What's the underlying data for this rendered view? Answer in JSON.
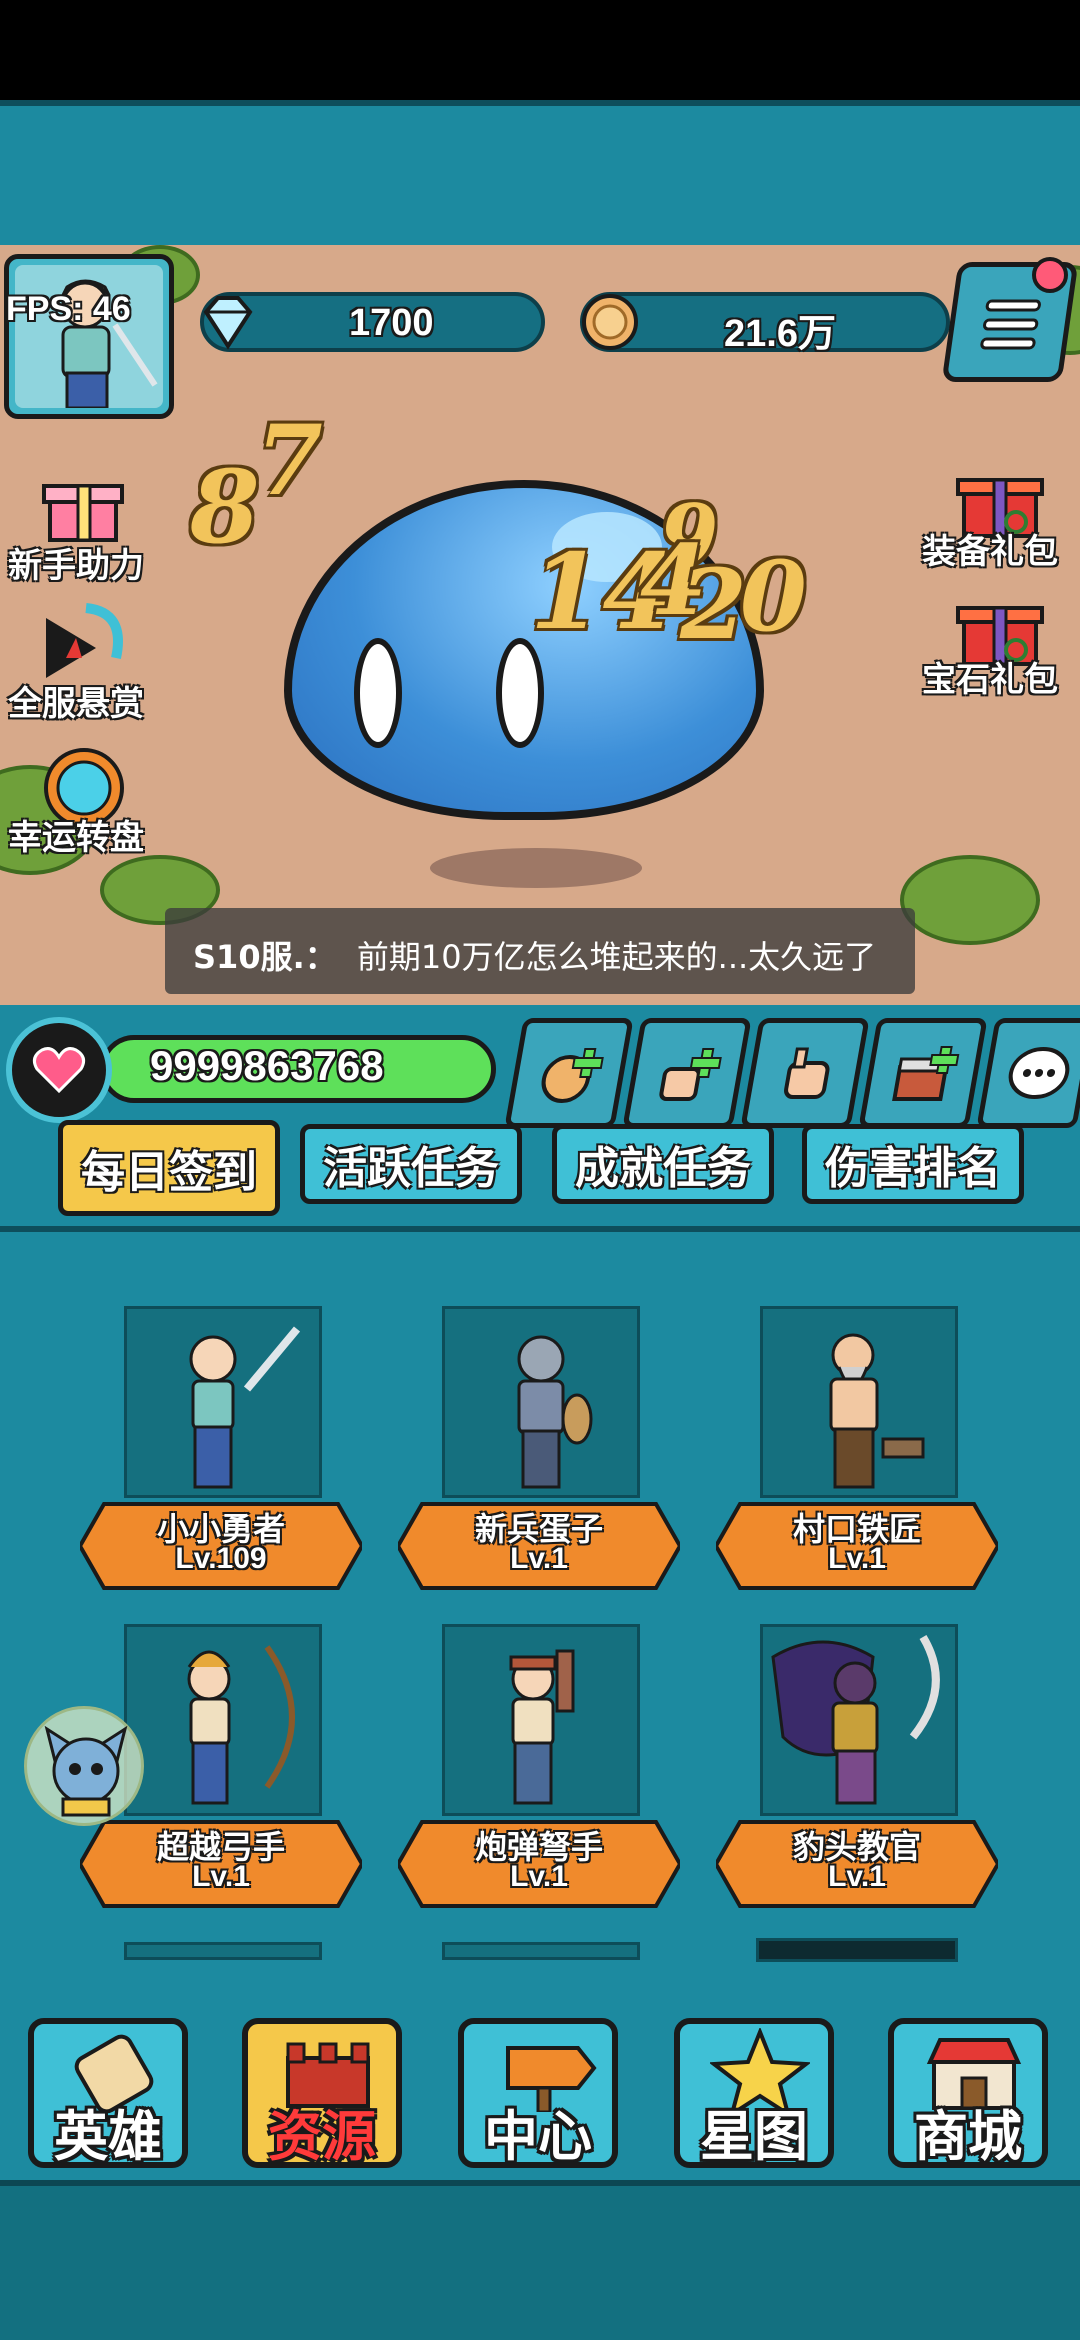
{
  "header": {
    "fps_label": "FPS: 46",
    "gems": "1700",
    "gold": "21.6万"
  },
  "side_left": [
    {
      "label": "新手助力",
      "icon": "gift-icon"
    },
    {
      "label": "全服悬赏",
      "icon": "bounty-icon"
    },
    {
      "label": "幸运转盘",
      "icon": "lucky-wheel-icon"
    }
  ],
  "side_right": [
    {
      "label": "装备礼包",
      "icon": "gift-box-icon"
    },
    {
      "label": "宝石礼包",
      "icon": "gift-box-icon"
    }
  ],
  "damage_numbers": [
    "8",
    "7",
    "9",
    "14",
    "4",
    "2",
    "0"
  ],
  "chat": {
    "sender": "S10服.：",
    "message": "前期10万亿怎么堆起来的...太久远了"
  },
  "hp": {
    "value": "9999863768"
  },
  "quick_buttons": [
    "add-gold-icon",
    "add-attack-icon",
    "punch-icon",
    "add-chest-icon",
    "chat-bubble-icon"
  ],
  "tabs": [
    {
      "label": "每日签到",
      "active": true
    },
    {
      "label": "活跃任务",
      "active": false
    },
    {
      "label": "成就任务",
      "active": false
    },
    {
      "label": "伤害排名",
      "active": false
    }
  ],
  "heroes": [
    {
      "name": "小小勇者",
      "level": "Lv.109"
    },
    {
      "name": "新兵蛋子",
      "level": "Lv.1"
    },
    {
      "name": "村口铁匠",
      "level": "Lv.1"
    },
    {
      "name": "超越弓手",
      "level": "Lv.1"
    },
    {
      "name": "炮弹弩手",
      "level": "Lv.1"
    },
    {
      "name": "豹头教官",
      "level": "Lv.1"
    }
  ],
  "nav": [
    {
      "label": "英雄",
      "active": false
    },
    {
      "label": "资源",
      "active": true
    },
    {
      "label": "中心",
      "active": false
    },
    {
      "label": "星图",
      "active": false
    },
    {
      "label": "商城",
      "active": false
    }
  ],
  "colors": {
    "frame": "#1c8aa0",
    "tab_active": "#f5c84a",
    "ribbon": "#f08a2c",
    "hp_bar": "#5ee05a"
  }
}
